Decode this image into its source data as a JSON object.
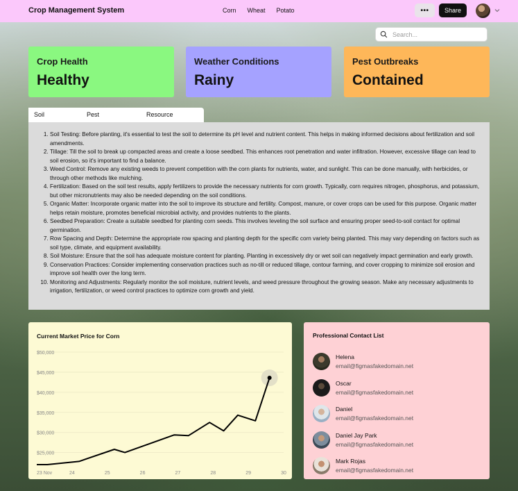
{
  "app": {
    "title": "Crop Management System"
  },
  "nav": {
    "items": [
      "Corn",
      "Wheat",
      "Potato"
    ]
  },
  "header": {
    "more_label": "•••",
    "share_label": "Share"
  },
  "search": {
    "placeholder": "Search..."
  },
  "cards": [
    {
      "title": "Crop Health",
      "value": "Healthy",
      "color": "#8af880"
    },
    {
      "title": "Weather Conditions",
      "value": "Rainy",
      "color": "#a5a2ff"
    },
    {
      "title": "Pest Outbreaks",
      "value": "Contained",
      "color": "#feb759"
    }
  ],
  "tabs": [
    "Soil Preparation",
    "Pest Management",
    "Resource Allocation"
  ],
  "soil_steps": [
    "Soil Testing: Before planting, it's essential to test the soil to determine its pH level and nutrient content. This helps in making informed decisions about fertilization and soil amendments.",
    "Tillage: Till the soil to break up compacted areas and create a loose seedbed. This enhances root penetration and water infiltration. However, excessive tillage can lead to soil erosion, so it's important to find a balance.",
    "Weed Control: Remove any existing weeds to prevent competition with the corn plants for nutrients, water, and sunlight. This can be done manually, with herbicides, or through other methods like mulching.",
    "Fertilization: Based on the soil test results, apply fertilizers to provide the necessary nutrients for corn growth. Typically, corn requires nitrogen, phosphorus, and potassium, but other micronutrients may also be needed depending on the soil conditions.",
    "Organic Matter: Incorporate organic matter into the soil to improve its structure and fertility. Compost, manure, or cover crops can be used for this purpose. Organic matter helps retain moisture, promotes beneficial microbial activity, and provides nutrients to the plants.",
    "Seedbed Preparation: Create a suitable seedbed for planting corn seeds. This involves leveling the soil surface and ensuring proper seed-to-soil contact for optimal germination.",
    "Row Spacing and Depth: Determine the appropriate row spacing and planting depth for the specific corn variety being planted. This may vary depending on factors such as soil type, climate, and equipment availability.",
    "Soil Moisture: Ensure that the soil has adequate moisture content for planting. Planting in excessively dry or wet soil can negatively impact germination and early growth.",
    "Conservation Practices: Consider implementing conservation practices such as no-till or reduced tillage, contour farming, and cover cropping to minimize soil erosion and improve soil health over the long term.",
    "Monitoring and Adjustments: Regularly monitor the soil moisture, nutrient levels, and weed pressure throughout the growing season. Make any necessary adjustments to irrigation, fertilization, or weed control practices to optimize corn growth and yield."
  ],
  "chart": {
    "title": "Current Market Price for Corn"
  },
  "chart_data": {
    "type": "line",
    "title": "Current Market Price for Corn",
    "xlabel": "",
    "ylabel": "",
    "x_ticks": [
      "23 Nov",
      "24",
      "25",
      "26",
      "27",
      "28",
      "29",
      "30"
    ],
    "y_ticks": [
      "$25,000",
      "$30,000",
      "$35,000",
      "$40,000",
      "$45,000",
      "$50,000"
    ],
    "ylim": [
      22000,
      50000
    ],
    "xlim": [
      23,
      30
    ],
    "grid": true,
    "line_color": "#000000",
    "series": [
      {
        "x": [
          23,
          23.3,
          24.2,
          25.2,
          25.5,
          26.9,
          27.3,
          27.9,
          28.3,
          28.7,
          29.2,
          29.6
        ],
        "y": [
          22000,
          22000,
          22800,
          25800,
          25000,
          29400,
          29200,
          32500,
          30400,
          34300,
          32900,
          43600
        ]
      }
    ]
  },
  "contacts": {
    "title": "Professional Contact List",
    "items": [
      {
        "name": "Helena",
        "email": "email@figmasfakedomain.net"
      },
      {
        "name": "Oscar",
        "email": "email@figmasfakedomain.net"
      },
      {
        "name": "Daniel",
        "email": "email@figmasfakedomain.net"
      },
      {
        "name": "Daniel Jay Park",
        "email": "email@figmasfakedomain.net"
      },
      {
        "name": "Mark Rojas",
        "email": "email@figmasfakedomain.net"
      }
    ]
  }
}
